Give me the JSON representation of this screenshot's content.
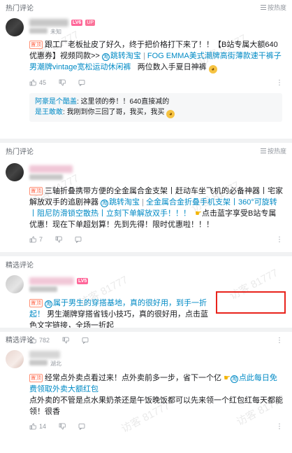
{
  "watermark": "访客 81777",
  "sections": [
    {
      "title": "热门评论",
      "sort_label": "按热度",
      "meta_suffix": "未知",
      "tag": "置顶",
      "text_1": "跟工厂老板扯皮了好久，终于把价格打下来了！！【B站专属大额640优惠券】视频同款>>",
      "link_1": "跳转淘宝",
      "link_2": "FOG EMMA美式潮牌高街薄款速干裤子男潮牌vintage宽松运动休闲裤",
      "text_2": "两位数入手夏日神裤",
      "likes": "45",
      "replies": [
        {
          "name": "阿豪是个酷盖",
          "text": "这里领的劵！！640直接减的"
        },
        {
          "name": "是王敢敢",
          "text": "我刚到你三回了哥，我买，我买"
        }
      ]
    },
    {
      "title": "热门评论",
      "sort_label": "按热度",
      "tag": "置顶",
      "text_1": "三轴折叠携带方便的全金属合金支架丨赶动车坐飞机的必备神器丨宅家解放双手的追剧神器",
      "link_1": "跳转淘宝",
      "link_2": "全金属合金折叠手机支架丨360°可旋转丨阻尼防滑锁空散热丨立刻下单解放双手！！！",
      "text_2": "点击蓝字享受B站专属优惠！现在下单超划算！先到先得！限时优惠啦！！！",
      "likes": "7"
    },
    {
      "title": "精选评论",
      "tag": "置顶",
      "link_1": "属于男生的穿搭基地，真的很好用，到手一折起！",
      "highlight_text": "男生潮牌穿搭省钱小技巧",
      "text_1": "男生潮牌穿搭省钱小技巧，真的很好用，点击蓝色文字链接，全场一折起",
      "likes": "782"
    },
    {
      "title": "精选评论",
      "meta_suffix": "湖北",
      "tag": "置顶",
      "text_1": "经常点外卖点看过来！点外卖前多一步，省下一个亿",
      "link_1": "点此每日免费领取外卖大额红包",
      "text_2": "点外卖的不管是点水果奶茶还是午饭晚饭都可以先来领一个红包红每天都能领！很香",
      "likes": "14"
    }
  ],
  "colors": {
    "link": "#008ac5",
    "tag": "#ff6a4d",
    "highlight": "#e8231c"
  }
}
